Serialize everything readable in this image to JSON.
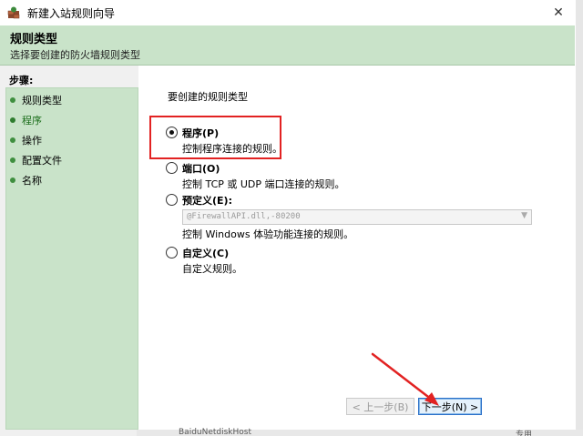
{
  "window": {
    "title": "新建入站规则向导",
    "close_glyph": "✕"
  },
  "header": {
    "title": "规则类型",
    "subtitle": "选择要创建的防火墙规则类型"
  },
  "steps": {
    "label": "步骤:",
    "items": [
      {
        "label": "规则类型"
      },
      {
        "label": "程序"
      },
      {
        "label": "操作"
      },
      {
        "label": "配置文件"
      },
      {
        "label": "名称"
      }
    ]
  },
  "content": {
    "prompt": "要创建的规则类型",
    "options": [
      {
        "title": "程序(P)",
        "desc": "控制程序连接的规则。",
        "checked": true
      },
      {
        "title": "端口(O)",
        "desc": "控制 TCP 或 UDP 端口连接的规则。",
        "checked": false
      },
      {
        "title": "预定义(E):",
        "desc": "控制 Windows 体验功能连接的规则。",
        "checked": false
      },
      {
        "title": "自定义(C)",
        "desc": "自定义规则。",
        "checked": false
      }
    ],
    "predefined_value": "@FirewallAPI.dll,-80200"
  },
  "buttons": {
    "back": "< 上一步(B)",
    "next": "下一步(N) >"
  },
  "background": {
    "row_text": "BaiduNetdiskHost",
    "row_right": "专用"
  },
  "colors": {
    "accent_green": "#c9e3c9",
    "highlight_red": "#e22222",
    "button_blue": "#2b70c9"
  }
}
